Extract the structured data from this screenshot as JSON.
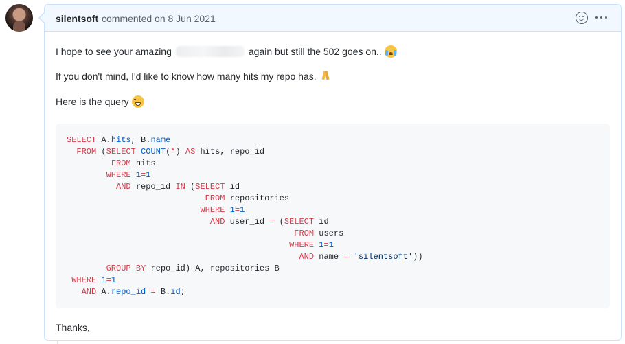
{
  "comment": {
    "author": "silentsoft",
    "meta": "commented on 8 Jun 2021",
    "icons": {
      "reaction": "smiley-icon",
      "menu": "kebab-icon",
      "avatar": "avatar"
    }
  },
  "body": {
    "p1_before": "I hope to see your amazing",
    "p1_after": "again but still the 502 goes on..",
    "p2": "If you don't mind, I'd like to know how many hits my repo has.",
    "p3": "Here is the query",
    "thanks": "Thanks,"
  },
  "code": {
    "lines": [
      [
        [
          "kw",
          "SELECT"
        ],
        [
          "",
          ""
        ],
        [
          "",
          ""
        ],
        [
          "",
          ""
        ],
        [
          "",
          ""
        ],
        [
          "",
          ""
        ],
        [
          "",
          ""
        ],
        [
          "",
          ""
        ],
        [
          "",
          ""
        ],
        [
          "",
          ""
        ]
      ],
      [],
      [],
      [],
      [],
      [],
      [],
      [],
      [],
      [],
      [],
      [],
      [],
      []
    ],
    "text": [
      "SELECT A.hits, B.name",
      "  FROM (SELECT COUNT(*) AS hits, repo_id",
      "         FROM hits",
      "        WHERE 1=1",
      "          AND repo_id IN (SELECT id",
      "                            FROM repositories",
      "                           WHERE 1=1",
      "                             AND user_id = (SELECT id",
      "                                              FROM users",
      "                                             WHERE 1=1",
      "                                               AND name = 'silentsoft'))",
      "        GROUP BY repo_id) A, repositories B",
      " WHERE 1=1",
      "   AND A.repo_id = B.id;"
    ]
  }
}
